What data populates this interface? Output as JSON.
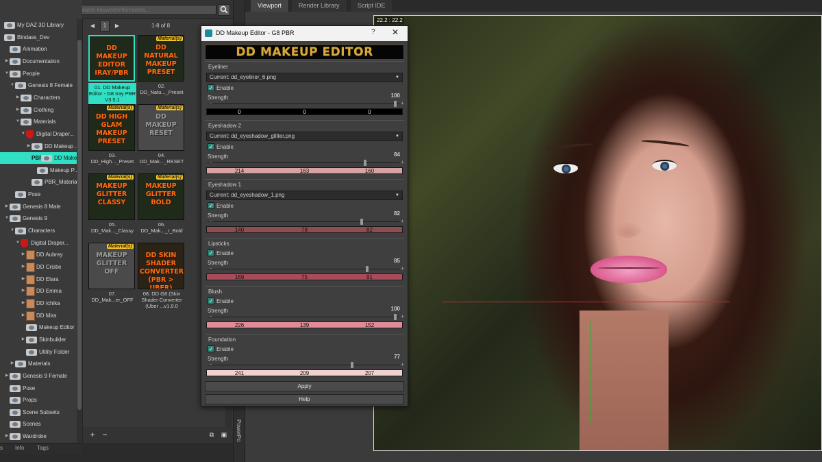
{
  "search": {
    "placeholder": "Enter text to search keywords/filenames..."
  },
  "tree": [
    {
      "label": "My DAZ 3D Library",
      "indent": 0,
      "arrow": "",
      "kind": "folder"
    },
    {
      "label": "Bindass_Dev",
      "indent": 0,
      "arrow": "",
      "kind": "folder"
    },
    {
      "label": "Animation",
      "indent": 1,
      "arrow": "",
      "kind": "folder"
    },
    {
      "label": "Documentation",
      "indent": 1,
      "arrow": "▶",
      "kind": "folder"
    },
    {
      "label": "People",
      "indent": 1,
      "arrow": "▼",
      "kind": "folder"
    },
    {
      "label": "Genesis 8 Female",
      "indent": 2,
      "arrow": "▼",
      "kind": "folder"
    },
    {
      "label": "Characters",
      "indent": 3,
      "arrow": "▶",
      "kind": "folder"
    },
    {
      "label": "Clothing",
      "indent": 3,
      "arrow": "▶",
      "kind": "folder"
    },
    {
      "label": "Materials",
      "indent": 3,
      "arrow": "▼",
      "kind": "folder"
    },
    {
      "label": "Digital Draper...",
      "indent": 4,
      "arrow": "▼",
      "kind": "shield"
    },
    {
      "label": "DD Makeup ...",
      "indent": 5,
      "arrow": "▶",
      "kind": "folder"
    },
    {
      "label": "DD Makeup ...",
      "indent": 5,
      "arrow": "▼",
      "kind": "folder",
      "prefix": "PBR",
      "selected": true
    },
    {
      "label": "Makeup P...",
      "indent": 6,
      "arrow": "",
      "kind": "folder"
    },
    {
      "label": "PBR_Material ...",
      "indent": 5,
      "arrow": "",
      "kind": "folder"
    },
    {
      "label": "Pose",
      "indent": 2,
      "arrow": "",
      "kind": "folder"
    },
    {
      "label": "Genesis 8 Male",
      "indent": 1,
      "arrow": "▶",
      "kind": "folder"
    },
    {
      "label": "Genesis 9",
      "indent": 1,
      "arrow": "▼",
      "kind": "folder"
    },
    {
      "label": "Characters",
      "indent": 2,
      "arrow": "▼",
      "kind": "folder"
    },
    {
      "label": "Digital Draper...",
      "indent": 3,
      "arrow": "▼",
      "kind": "shield"
    },
    {
      "label": "DD Aubrey",
      "indent": 4,
      "arrow": "▶",
      "kind": "avatar"
    },
    {
      "label": "DD Cristie",
      "indent": 4,
      "arrow": "▶",
      "kind": "avatar"
    },
    {
      "label": "DD Elara",
      "indent": 4,
      "arrow": "▶",
      "kind": "avatar"
    },
    {
      "label": "DD Emma",
      "indent": 4,
      "arrow": "▶",
      "kind": "avatar"
    },
    {
      "label": "DD Ichika",
      "indent": 4,
      "arrow": "▶",
      "kind": "avatar"
    },
    {
      "label": "DD Mira",
      "indent": 4,
      "arrow": "▶",
      "kind": "avatar"
    },
    {
      "label": "Makeup Editor",
      "indent": 4,
      "arrow": "",
      "kind": "folder"
    },
    {
      "label": "Skinbuilder",
      "indent": 4,
      "arrow": "▶",
      "kind": "folder"
    },
    {
      "label": "Utility Folder",
      "indent": 4,
      "arrow": "",
      "kind": "folder"
    },
    {
      "label": "Materials",
      "indent": 2,
      "arrow": "▶",
      "kind": "folder"
    },
    {
      "label": "Genesis 9 Female",
      "indent": 1,
      "arrow": "▶",
      "kind": "folder"
    },
    {
      "label": "Pose",
      "indent": 1,
      "arrow": "",
      "kind": "folder"
    },
    {
      "label": "Props",
      "indent": 1,
      "arrow": "",
      "kind": "folder"
    },
    {
      "label": "Scene Subsets",
      "indent": 1,
      "arrow": "",
      "kind": "folder"
    },
    {
      "label": "Scenes",
      "indent": 1,
      "arrow": "",
      "kind": "folder"
    },
    {
      "label": "Wardrobe",
      "indent": 1,
      "arrow": "▶",
      "kind": "folder"
    }
  ],
  "left_tabs": [
    "s",
    "Info",
    "Tags"
  ],
  "pager": {
    "page": "1",
    "range": "1-8 of 8"
  },
  "thumbs": [
    {
      "badge": "",
      "title": "DD MAKEUP EDITOR IRAY/PBR",
      "caption": "01. DD Makeup Editor - G8 Iray PBR V3.5.1",
      "style": "",
      "selected": true
    },
    {
      "badge": "Material(s)",
      "title": "DD NATURAL MAKEUP PRESET",
      "caption": "02. DD_Natu..._Preset",
      "style": "",
      "selected": false
    },
    {
      "badge": "Material(s)",
      "title": "DD HIGH GLAM MAKEUP PRESET",
      "caption": "03. DD_High..._Preset",
      "style": "",
      "selected": false
    },
    {
      "badge": "Material(s)",
      "title": "DD MAKEUP RESET",
      "caption": "04. DD_Mak..._RESET",
      "style": "grey",
      "selected": false
    },
    {
      "badge": "Material(s)",
      "title": "MAKEUP GLITTER CLASSY",
      "caption": "05. DD_Mak..._Classy",
      "style": "",
      "selected": false
    },
    {
      "badge": "Material(s)",
      "title": "MAKEUP GLITTER BOLD",
      "caption": "06. DD_Mak..._r_Bold",
      "style": "",
      "selected": false
    },
    {
      "badge": "Material(s)",
      "title": "MAKEUP GLITTER OFF",
      "caption": "07. DD_Mak...er_OFF",
      "style": "grey",
      "selected": false
    },
    {
      "badge": "",
      "title": "DD SKIN SHADER CONVERTER (PBR > UBER)",
      "caption": "08. DD G8 (Skin Shader Converter (Uber ...v1.0.0",
      "style": "dark",
      "selected": false
    }
  ],
  "side_label": "PowerPo",
  "viewport": {
    "tabs": [
      "Viewport",
      "Render Library",
      "Script IDE"
    ],
    "active_tab": 0,
    "coord": "22.2 : 22.2"
  },
  "dialog": {
    "title": "DD Makeup Editor - G8 PBR",
    "help": "?",
    "close": "✕",
    "banner": "DD MAKEUP EDITOR",
    "strength_label": "Strength",
    "enable_label": "Enable",
    "sections": [
      {
        "name": "Eyeliner",
        "current": "Current: dd_eyeliner_6.png",
        "strength": 100,
        "rgb": [
          0,
          0,
          0
        ],
        "color": "#000000",
        "dark": true
      },
      {
        "name": "Eyeshadow 2",
        "current": "Current: dd_eyeshadow_glitter.png",
        "strength": 84,
        "rgb": [
          214,
          163,
          160
        ],
        "color": "#d6a3a0",
        "dark": false
      },
      {
        "name": "Eyeshadow 1",
        "current": "Current: dd_eyeshadow_1.png",
        "strength": 82,
        "rgb": [
          140,
          78,
          82
        ],
        "color": "#8c4e52",
        "dark": false
      },
      {
        "name": "Lipsticks",
        "current": "",
        "strength": 85,
        "rgb": [
          169,
          75,
          91
        ],
        "color": "#a94b5b",
        "dark": false
      },
      {
        "name": "Blush",
        "current": "",
        "strength": 100,
        "rgb": [
          226,
          139,
          152
        ],
        "color": "#e28b98",
        "dark": false
      },
      {
        "name": "Foundation",
        "current": "",
        "strength": 77,
        "rgb": [
          241,
          209,
          207
        ],
        "color": "#f1d1cf",
        "dark": false
      }
    ],
    "apply": "Apply",
    "help_button": "Help"
  }
}
